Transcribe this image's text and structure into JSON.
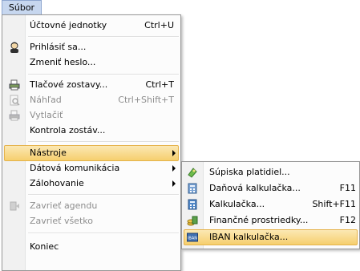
{
  "menubar": {
    "label": "Súbor"
  },
  "main_menu": {
    "accounting_units": {
      "label": "Účtovné jednotky",
      "shortcut": "Ctrl+U"
    },
    "login_as": {
      "label": "Prihlásiť sa..."
    },
    "change_password": {
      "label": "Zmeniť heslo..."
    },
    "print_reports": {
      "label": "Tlačové zostavy...",
      "shortcut": "Ctrl+T"
    },
    "preview": {
      "label": "Náhľad",
      "shortcut": "Ctrl+Shift+T"
    },
    "print": {
      "label": "Vytlačiť"
    },
    "check_reports": {
      "label": "Kontrola zostáv..."
    },
    "tools": {
      "label": "Nástroje"
    },
    "data_communication": {
      "label": "Dátová komunikácia"
    },
    "backup": {
      "label": "Zálohovanie"
    },
    "close_agenda": {
      "label": "Zavrieť agendu"
    },
    "close_all": {
      "label": "Zavrieť všetko"
    },
    "exit": {
      "label": "Koniec"
    }
  },
  "tools_submenu": {
    "payment_list": {
      "label": "Súpiska platidiel..."
    },
    "tax_calculator": {
      "label": "Daňová kalkulačka...",
      "shortcut": "F11"
    },
    "calculator": {
      "label": "Kalkulačka...",
      "shortcut": "Shift+F11"
    },
    "financial_means": {
      "label": "Finančné prostriedky...",
      "shortcut": "F12"
    },
    "iban_calculator": {
      "label": "IBAN kalkulačka...",
      "icon_text": "IBAN"
    }
  },
  "colors": {
    "highlight": "#f6cf6e",
    "menubar_active": "#c7d7ef",
    "disabled_text": "#8d8d8d"
  }
}
